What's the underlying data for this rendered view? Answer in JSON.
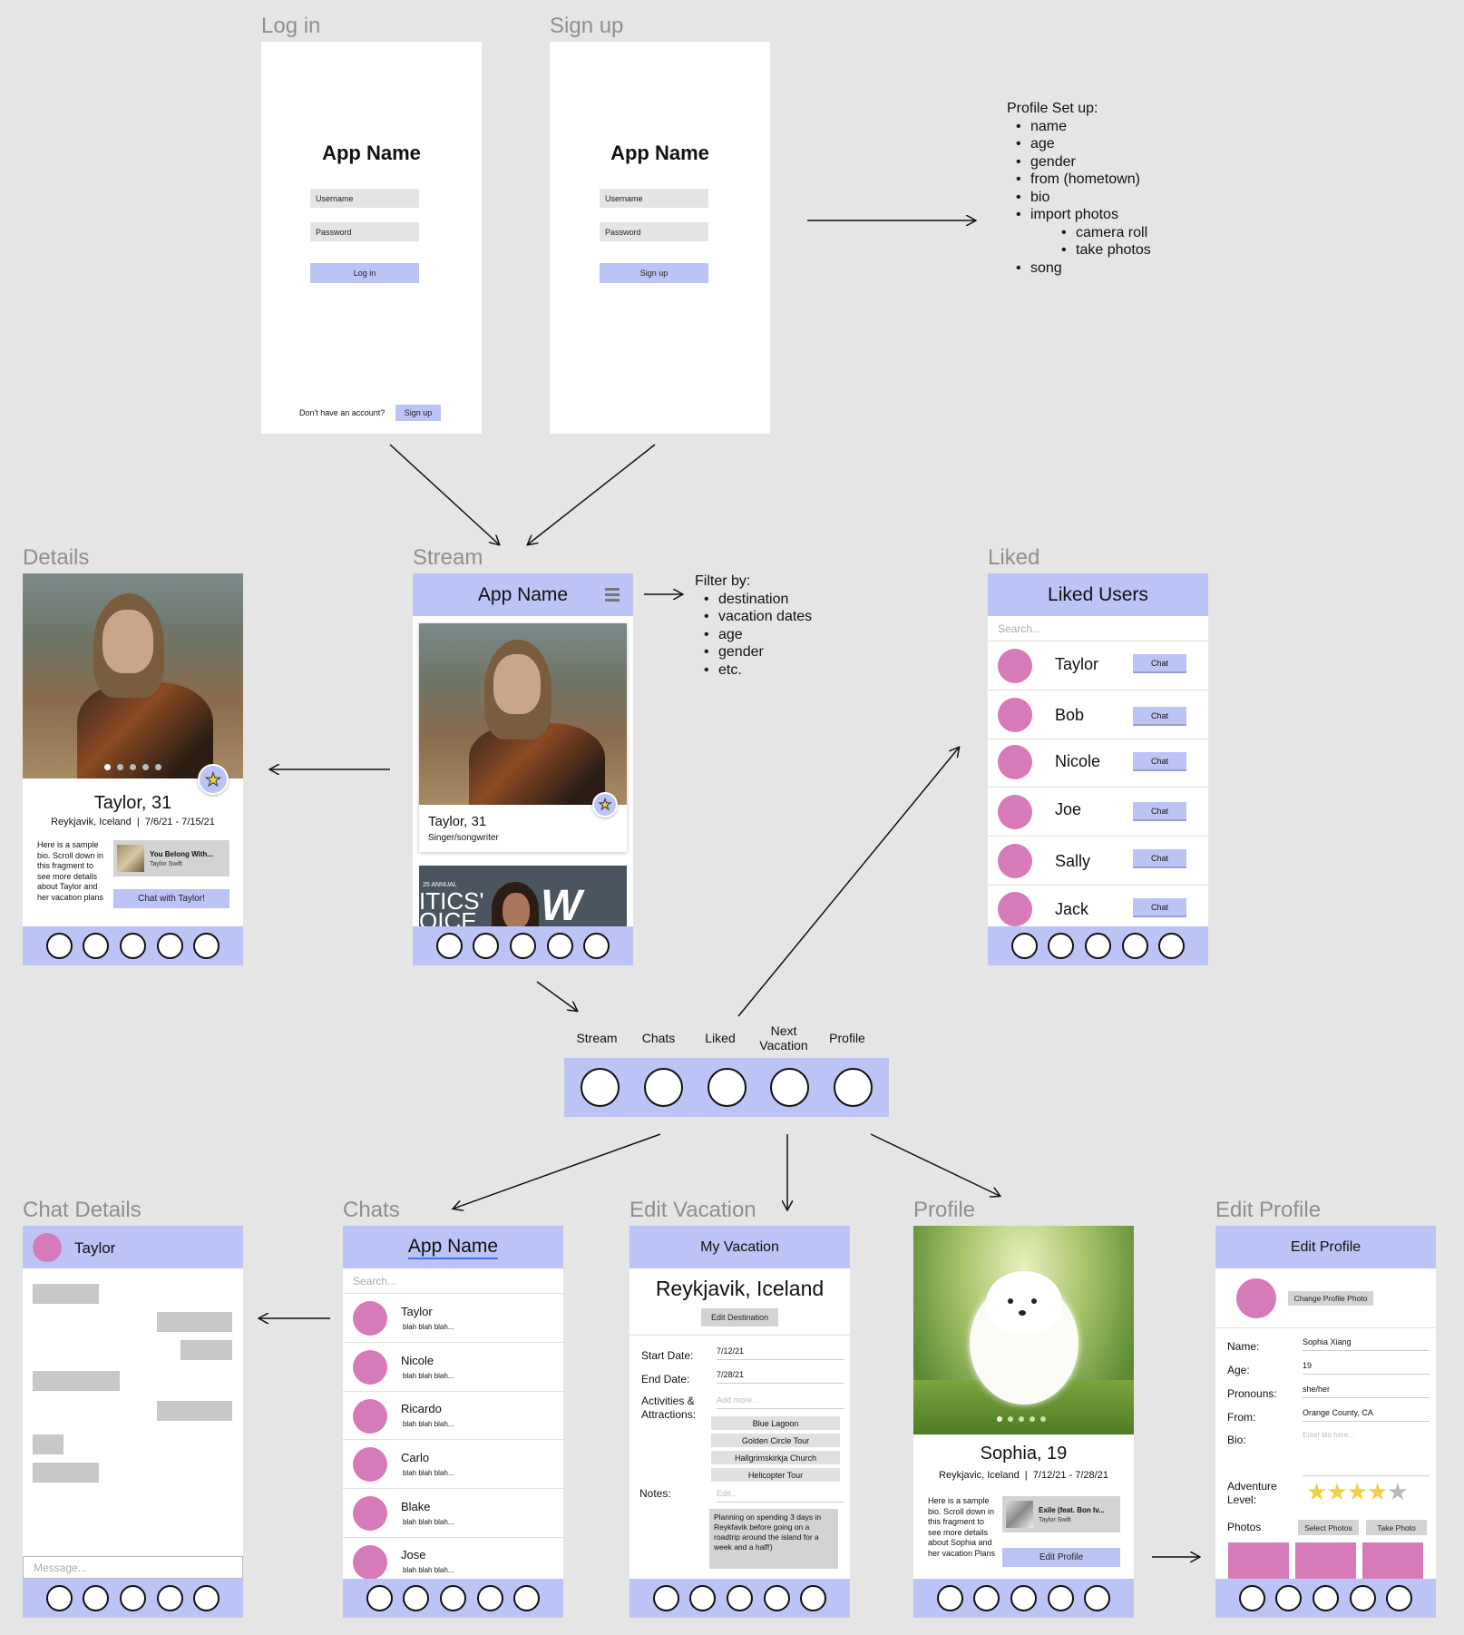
{
  "screens": {
    "login": {
      "label": "Log in",
      "app_name": "App Name",
      "username_ph": "Username",
      "password_ph": "Password",
      "button": "Log in",
      "no_account": "Don't have an account?",
      "signup_button": "Sign up"
    },
    "signup": {
      "label": "Sign up",
      "app_name": "App Name",
      "username_ph": "Username",
      "password_ph": "Password",
      "button": "Sign up"
    },
    "profile_setup": {
      "title": "Profile Set up:",
      "items": [
        "name",
        "age",
        "gender",
        "from (hometown)",
        "bio",
        "import photos"
      ],
      "sub_items": [
        "camera roll",
        "take photos"
      ],
      "last_item": "song"
    },
    "details": {
      "label": "Details",
      "name_age": "Taylor, 31",
      "location": "Reykjavik, Iceland",
      "dates": "7/6/21 - 7/15/21",
      "bio": "Here is a sample bio. Scroll down in this fragment to see more details about Taylor and her vacation plans",
      "song_title": "You Belong With...",
      "song_artist": "Taylor Swift",
      "chat_button": "Chat with Taylor!"
    },
    "stream": {
      "label": "Stream",
      "header": "App Name",
      "card_name": "Taylor, 31",
      "card_sub": "Singer/songwriter",
      "second_card_text": "ITICS' OICE",
      "second_card_small": "25 ANNUAL"
    },
    "filter": {
      "title": "Filter by:",
      "items": [
        "destination",
        "vacation dates",
        "age",
        "gender",
        "etc."
      ]
    },
    "liked": {
      "label": "Liked",
      "header": "Liked Users",
      "search_ph": "Search...",
      "chat_label": "Chat",
      "users": [
        "Taylor",
        "Bob",
        "Nicole",
        "Joe",
        "Sally",
        "Jack"
      ]
    },
    "navbar": {
      "labels": [
        "Stream",
        "Chats",
        "Liked",
        "Next Vacation",
        "Profile"
      ]
    },
    "chat_details": {
      "label": "Chat Details",
      "name": "Taylor",
      "message_ph": "Message..."
    },
    "chats": {
      "label": "Chats",
      "header": "App Name",
      "search_ph": "Search...",
      "preview": "blah blah blah...",
      "users": [
        "Taylor",
        "Nicole",
        "Ricardo",
        "Carlo",
        "Blake",
        "Jose"
      ]
    },
    "edit_vacation": {
      "label": "Edit Vacation",
      "header": "My Vacation",
      "destination": "Reykjavik, Iceland",
      "edit_dest": "Edit Destination",
      "start_label": "Start Date:",
      "start_val": "7/12/21",
      "end_label": "End Date:",
      "end_val": "7/28/21",
      "act_label": "Activities & Attractions:",
      "add_more": "Add more...",
      "attractions": [
        "Blue Lagoon",
        "Golden Circle Tour",
        "Hallgrimskirkja Church",
        "Helicopter Tour"
      ],
      "notes_label": "Notes:",
      "edit_ph": "Edit...",
      "notes": "Planning on spending 3 days in Reykfavik before going on a roadtrip around the island for a week and a half!)"
    },
    "profile": {
      "label": "Profile",
      "name_age": "Sophia, 19",
      "location": "Reykjavic, Iceland",
      "dates": "7/12/21 - 7/28/21",
      "bio": "Here is a sample bio. Scroll down in this fragment to see more details about Sophia and her vacation Plans",
      "song_title": "Exile (feat. Bon Iv...",
      "song_artist": "Taylor Swift",
      "edit_button": "Edit Profile"
    },
    "edit_profile": {
      "label": "Edit Profile",
      "header": "Edit Profile",
      "change_photo": "Change Profile Photo",
      "name_label": "Name:",
      "name_val": "Sophia Xiang",
      "age_label": "Age:",
      "age_val": "19",
      "pron_label": "Pronouns:",
      "pron_val": "she/her",
      "from_label": "From:",
      "from_val": "Orange County, CA",
      "bio_label": "Bio:",
      "bio_ph": "Enter bio here...",
      "adv_label": "Adventure Level:",
      "adventure_level": 4,
      "adventure_max": 5,
      "photos_label": "Photos",
      "select_photos": "Select Photos",
      "take_photo": "Take Photo"
    }
  },
  "colors": {
    "accent": "#bcc3f5",
    "avatar": "#d77ab8",
    "background": "#e5e5e5"
  }
}
